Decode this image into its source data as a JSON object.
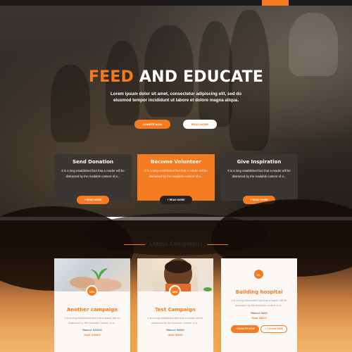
{
  "hero": {
    "title_accent": "FEED",
    "title_rest": " AND EDUCATE",
    "subtitle": "Lorem ipsum dolor sit amet, consectetur adipiscing elit, sed do eiusmod tempor incididunt ut labore et dolore magna aliqua.",
    "donate_label": "DONATE NOW",
    "read_label": "READ MORE"
  },
  "features": [
    {
      "title": "Send Donation",
      "text": "It is a long established fact that a reader will be distracted by the readable content of a...",
      "button": "+ READ MORE"
    },
    {
      "title": "Become Volunteer",
      "text": "It is a long established fact that a reader will be distracted by the readable content of a...",
      "button": "+ READ MORE"
    },
    {
      "title": "Give Inspiration",
      "text": "It is a long established fact that a reader will be distracted by the readable content of a...",
      "button": "+ READ MORE"
    }
  ],
  "campaigns": {
    "heading": "Latest Campaigns",
    "items": [
      {
        "badge": "18%",
        "title": "Another campaign",
        "text": "It is a long established fact that a reader will be distracted by the readable content of a...",
        "raised": "Raised: $13000",
        "goal": "Goal: $15400"
      },
      {
        "badge": "65%",
        "title": "Test Campaign",
        "text": "It is a long established fact that a reader will be distracted by the readable content of a...",
        "raised": "Raised: $3000",
        "goal": "Goal: $5540"
      },
      {
        "badge": "0%",
        "title": "Building hospital",
        "text": "It is a long established fact that a reader will be distracted by the readable content of a...",
        "raised": "Raised: $400",
        "goal": "Goal: $3870",
        "donate": "+ DONATE NOW",
        "donators": "+ 2 DONATORS"
      }
    ]
  },
  "colors": {
    "accent": "#f47b20",
    "dark": "#3a3634"
  }
}
